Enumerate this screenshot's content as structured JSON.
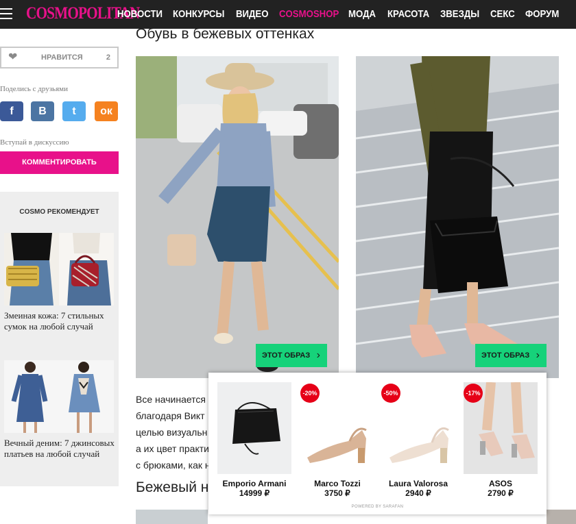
{
  "nav": {
    "logo": "COSMOPOLITAN",
    "items": [
      "НОВОСТИ",
      "КОНКУРСЫ",
      "ВИДЕО",
      "COSMOSHOP",
      "МОДА",
      "КРАСОТА",
      "ЗВЕЗДЫ",
      "СЕКС",
      "ФОРУМ"
    ],
    "accent_color": "#e8118a"
  },
  "sidebar": {
    "like_label": "НРАВИТСЯ",
    "like_count": "2",
    "share_label": "Поделись с друзьями",
    "social": [
      "f",
      "B",
      "t",
      "ок"
    ],
    "discuss_label": "Вступай в дискуссию",
    "comment_button": "КОММЕНТИРОВАТЬ",
    "recommend_title": "COSMO РЕКОМЕНДУЕТ",
    "rec1_text": "Змеиная кожа: 7 стильных сумок на любой случай",
    "rec2_text": "Вечный деним: 7 джинсовых платьев на любой случай"
  },
  "main": {
    "title": "Обувь в бежевых оттенках",
    "look_button": "ЭТОТ ОБРАЗ",
    "body_lines": [
      "Все начинается",
      "благодаря Викт",
      "целью визуальн",
      "а их цвет практи",
      "с брюками, как н"
    ],
    "title2": "Бежевый н"
  },
  "popup": {
    "products": [
      {
        "brand": "Emporio Armani",
        "price": "14999 ₽",
        "discount": ""
      },
      {
        "brand": "Marco Tozzi",
        "price": "3750 ₽",
        "discount": "-20%"
      },
      {
        "brand": "Laura Valorosa",
        "price": "2940 ₽",
        "discount": "-50%"
      },
      {
        "brand": "ASOS",
        "price": "2790 ₽",
        "discount": "-17%"
      }
    ],
    "powered_by": "POWERED BY SARAFAN"
  },
  "icons": [
    "menu-icon",
    "heart-icon",
    "facebook-icon",
    "vk-icon",
    "twitter-icon",
    "odnoklassniki-icon",
    "chevron-right-icon"
  ]
}
